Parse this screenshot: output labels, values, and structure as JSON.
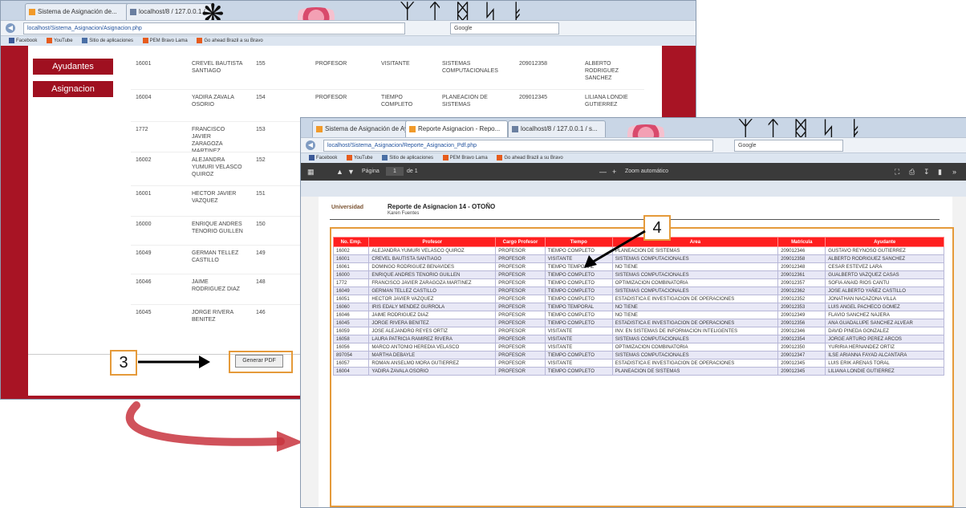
{
  "browser_back": {
    "tabs": [
      "Sistema de Asignación de...",
      "localhost/8 / 127.0.0.1 /"
    ],
    "address": "localhost/Sistema_Asignacion/Asignacion.php",
    "search": "Google",
    "bookmarks": [
      "Facebook",
      "YouTube",
      "Sitio de aplicaciones",
      "PEM Bravo Lama",
      "Go ahead Brazil a su Bravo"
    ],
    "sidebar": {
      "items": [
        "Ayudantes",
        "Asignacion"
      ]
    },
    "rows": [
      {
        "id": "16001",
        "name": "CREVEL BAUTISTA SANTIAGO",
        "num": "155",
        "cargo": "PROFESOR",
        "tipo": "VISITANTE",
        "area": "SISTEMAS COMPUTACIONALES",
        "mat": "209012358",
        "ayud": "ALBERTO RODRIGUEZ SANCHEZ"
      },
      {
        "id": "16004",
        "name": "YADIRA ZAVALA OSORIO",
        "num": "154",
        "cargo": "PROFESOR",
        "tipo": "TIEMPO COMPLETO",
        "area": "PLANEACION DE SISTEMAS",
        "mat": "209012345",
        "ayud": "LILIANA LONDIE GUTIERREZ"
      },
      {
        "id": "1772",
        "name": "FRANCISCO JAVIER ZARAGOZA MARTINEZ",
        "num": "153",
        "cargo": "",
        "tipo": "",
        "area": "",
        "mat": "",
        "ayud": ""
      },
      {
        "id": "16002",
        "name": "ALEJANDRA YUMURI VELASCO QUIROZ",
        "num": "152",
        "cargo": "",
        "tipo": "",
        "area": "",
        "mat": "",
        "ayud": ""
      },
      {
        "id": "16001",
        "name": "HECTOR JAVIER VAZQUEZ",
        "num": "151",
        "cargo": "",
        "tipo": "",
        "area": "",
        "mat": "",
        "ayud": ""
      },
      {
        "id": "16000",
        "name": "ENRIQUE ANDRES TENORIO GUILLEN",
        "num": "150",
        "cargo": "",
        "tipo": "",
        "area": "",
        "mat": "",
        "ayud": ""
      },
      {
        "id": "16049",
        "name": "GERMAN TELLEZ CASTILLO",
        "num": "149",
        "cargo": "",
        "tipo": "",
        "area": "",
        "mat": "",
        "ayud": ""
      },
      {
        "id": "16046",
        "name": "JAIME RODRIGUEZ DIAZ",
        "num": "148",
        "cargo": "",
        "tipo": "",
        "area": "",
        "mat": "",
        "ayud": ""
      },
      {
        "id": "16045",
        "name": "JORGE RIVERA BENITEZ",
        "num": "146",
        "cargo": "",
        "tipo": "",
        "area": "",
        "mat": "",
        "ayud": ""
      }
    ],
    "generate_button": "Generar PDF"
  },
  "browser_front": {
    "tabs": [
      "Sistema de Asignación de Ayu...",
      "Reporte Asignacion - Repo...",
      "localhost/8 / 127.0.0.1 / s..."
    ],
    "address": "localhost/Sistema_Asignacion/Reporte_Asignacion_Pdf.php",
    "search": "Google",
    "bookmarks": [
      "Facebook",
      "YouTube",
      "Sitio de aplicaciones",
      "PEM Bravo Lama",
      "Go ahead Brazil a su Bravo"
    ],
    "pdf_toolbar": {
      "page_label": "Página",
      "page_value": "1",
      "page_total": "de 1",
      "zoom": "Zoom automático"
    },
    "report": {
      "logo": "Universidad",
      "title": "Reporte de Asignacion 14 - OTOÑO",
      "subtitle": "Karen Fuentes",
      "headers": [
        "No. Emp.",
        "Profesor",
        "Cargo Profesor",
        "Tiempo",
        "Area",
        "Matricula",
        "Ayudante"
      ],
      "rows": [
        [
          "16002",
          "ALEJANDRA YUMURI VELASCO QUIROZ",
          "PROFESOR",
          "TIEMPO COMPLETO",
          "PLANEACION DE SISTEMAS",
          "209012346",
          "GUSTAVO REYNOSO GUTIERREZ"
        ],
        [
          "16001",
          "CREVEL BAUTISTA SANTIAGO",
          "PROFESOR",
          "VISITANTE",
          "SISTEMAS COMPUTACIONALES",
          "209012358",
          "ALBERTO RODRIGUEZ SANCHEZ"
        ],
        [
          "16061",
          "DOMINGO RODRIGUEZ BENAVIDES",
          "PROFESOR",
          "TIEMPO TEMPORAL",
          "NO TIENE",
          "209012348",
          "CESAR ESTEVEZ LARA"
        ],
        [
          "16000",
          "ENRIQUE ANDRES TENORIO GUILLEN",
          "PROFESOR",
          "TIEMPO COMPLETO",
          "SISTEMAS COMPUTACIONALES",
          "209012361",
          "GUALBERTO VAZQUEZ CASAS"
        ],
        [
          "1772",
          "FRANCISCO JAVIER ZARAGOZA MARTINEZ",
          "PROFESOR",
          "TIEMPO COMPLETO",
          "OPTIMIZACION COMBINATORIA",
          "209012357",
          "SOFIA ANAID RIOS CANTU"
        ],
        [
          "16049",
          "GERMAN TELLEZ CASTILLO",
          "PROFESOR",
          "TIEMPO COMPLETO",
          "SISTEMAS COMPUTACIONALES",
          "209012362",
          "JOSE ALBERTO YAÑEZ CASTILLO"
        ],
        [
          "16051",
          "HECTOR JAVIER VAZQUEZ",
          "PROFESOR",
          "TIEMPO COMPLETO",
          "ESTADISTICA E INVESTIGACION DE OPERACIONES",
          "209012352",
          "JONATHAN NACAZONA VILLA"
        ],
        [
          "16060",
          "IRIS EDALY MENDEZ GURROLA",
          "PROFESOR",
          "TIEMPO TEMPORAL",
          "NO TIENE",
          "209012353",
          "LUIS ANGEL PACHECO GOMEZ"
        ],
        [
          "16046",
          "JAIME RODRIGUEZ DIAZ",
          "PROFESOR",
          "TIEMPO COMPLETO",
          "NO TIENE",
          "209012349",
          "FLAVIO SANCHEZ NAJERA"
        ],
        [
          "16045",
          "JORGE RIVERA BENITEZ",
          "PROFESOR",
          "TIEMPO COMPLETO",
          "ESTADISTICA E INVESTIGACION DE OPERACIONES",
          "209012356",
          "ANA GUADALUPE SANCHEZ ALVEAR"
        ],
        [
          "16059",
          "JOSE ALEJANDRO REYES ORTIZ",
          "PROFESOR",
          "VISITANTE",
          "INV. EN SISTEMAS DE INFORMACION INTELIGENTES",
          "209012346",
          "DAVID PINEDA GONZALEZ"
        ],
        [
          "16058",
          "LAURA PATRICIA RAMIREZ RIVERA",
          "PROFESOR",
          "VISITANTE",
          "SISTEMAS COMPUTACIONALES",
          "209012354",
          "JORGE ARTURO PEREZ ARCOS"
        ],
        [
          "16056",
          "MARCO ANTONIO HEREDIA VELASCO",
          "PROFESOR",
          "VISITANTE",
          "OPTIMIZACION COMBINATORIA",
          "209012350",
          "YURIRIA HERNANDEZ ORTIZ"
        ],
        [
          "897054",
          "MARTHA DEBAYLE",
          "PROFESOR",
          "TIEMPO COMPLETO",
          "SISTEMAS COMPUTACIONALES",
          "209012347",
          "ILSE ARIANNA FAYAD ALCANTARA"
        ],
        [
          "16057",
          "ROMAN ANSELMO MORA GUTIERREZ",
          "PROFESOR",
          "VISITANTE",
          "ESTADISTICA E INVESTIGACION DE OPERACIONES",
          "209012345",
          "LUIS ERIK ARENAS TORAL"
        ],
        [
          "16004",
          "YADIRA ZAVALA OSORIO",
          "PROFESOR",
          "TIEMPO COMPLETO",
          "PLANEACION DE SISTEMAS",
          "209012345",
          "LILIANA LONDIE GUTIERREZ"
        ]
      ]
    }
  },
  "callouts": [
    "3",
    "4"
  ],
  "colors": {
    "accent_red": "#a81424",
    "header_red": "#ff1f1f",
    "callout_orange": "#e59a3a"
  }
}
